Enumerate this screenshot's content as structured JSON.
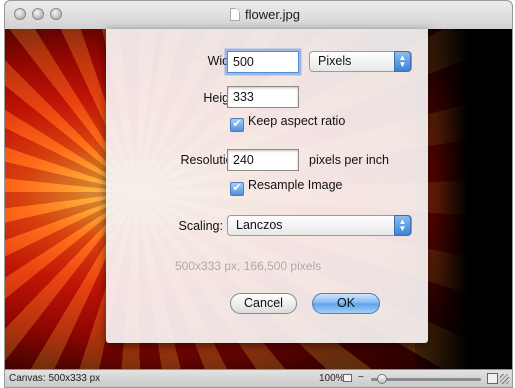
{
  "window": {
    "title": "flower.jpg"
  },
  "dialog": {
    "width_label": "Width:",
    "width_value": "500",
    "unit_value": "Pixels",
    "height_label": "Height:",
    "height_value": "333",
    "keep_aspect_label": "Keep aspect ratio",
    "keep_aspect_checked": true,
    "resolution_label": "Resolution:",
    "resolution_value": "240",
    "resolution_unit": "pixels per inch",
    "resample_label": "Resample Image",
    "resample_checked": true,
    "scaling_label": "Scaling:",
    "scaling_value": "Lanczos",
    "summary": "500x333 px, 166,500 pixels",
    "cancel_label": "Cancel",
    "ok_label": "OK"
  },
  "statusbar": {
    "canvas_info": "Canvas: 500x333 px",
    "zoom_text": "100%",
    "zoom_minus": "−"
  },
  "icons": {
    "checkmark": "✔",
    "stepper_up": "▲",
    "stepper_down": "▼"
  },
  "colors": {
    "accent": "#4f90df",
    "summary_text": "#ababab"
  }
}
